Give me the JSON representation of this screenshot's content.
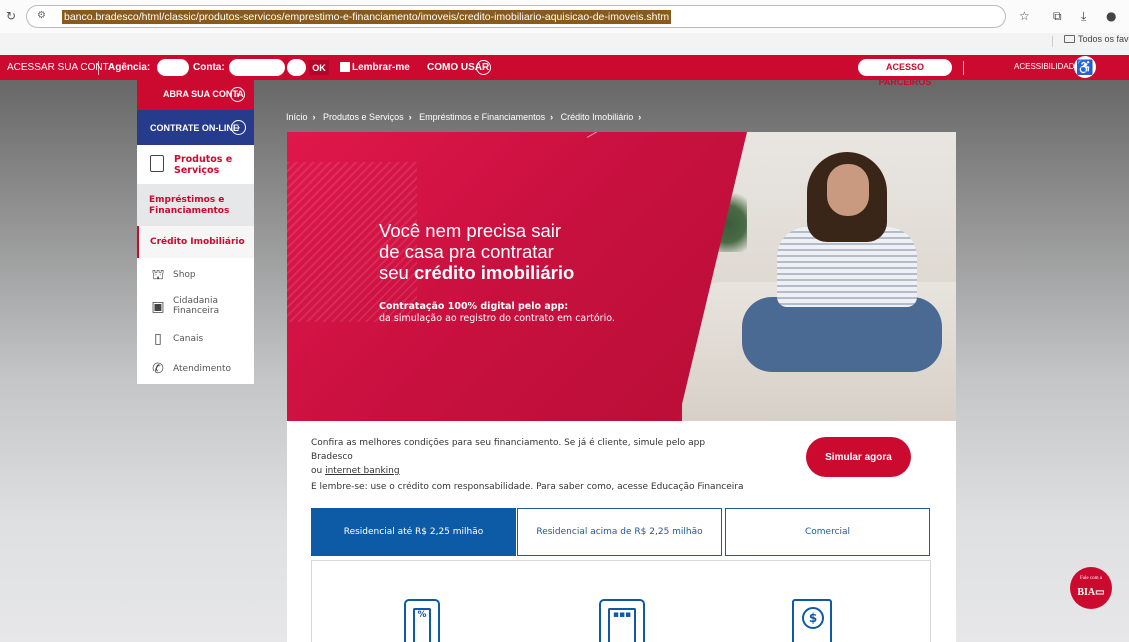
{
  "browser": {
    "url": "banco.bradesco/html/classic/produtos-servicos/emprestimo-e-financiamento/imoveis/credito-imobiliario-aquisicao-de-imoveis.shtm",
    "bookmarks_label": "Todos os favoritos"
  },
  "topbar": {
    "access_label": "ACESSAR SUA CONTA",
    "agency_label": "Agência:",
    "account_label": "Conta:",
    "ok_label": "OK",
    "remember_label": "Lembrar-me",
    "how_to_use_label": "COMO USAR",
    "partners_label": "ACESSO PARCEIROS",
    "accessibility_label": "ACESSIBILIDADE"
  },
  "menu": {
    "open_account": "ABRA SUA CONTA",
    "contract_online": "CONTRATE ON-LINE",
    "products": "Produtos e Serviços",
    "loans": "Empréstimos e Financiamentos",
    "current": "Crédito Imobiliário",
    "items": [
      {
        "label": "Shop"
      },
      {
        "label": "Cidadania Financeira"
      },
      {
        "label": "Canais"
      },
      {
        "label": "Atendimento"
      }
    ]
  },
  "breadcrumb": [
    "Início",
    "Produtos e Serviços",
    "Empréstimos e Financiamentos",
    "Crédito Imobiliário"
  ],
  "banner": {
    "line1": "Você nem precisa sair",
    "line2": "de casa pra contratar",
    "line3_prefix": "seu ",
    "line3_bold": "crédito imobiliário",
    "sub_bold": "Contratação 100% digital pelo app:",
    "sub_normal": "da simulação ao registro do contrato em cartório."
  },
  "content": {
    "intro_text": "Confira as melhores condições para seu financiamento. Se já é cliente, simule pelo app Bradesco",
    "intro_or": "ou ",
    "intro_link": "internet banking",
    "simulate_button": "Simular agora",
    "reminder_text": "E lembre-se: use o crédito com responsabilidade. Para saber como, acesse Educação Financeira",
    "tabs": [
      {
        "label": "Residencial até R$ 2,25 milhão",
        "active": true
      },
      {
        "label": "Residencial acima de R$ 2,25 milhão",
        "active": false
      },
      {
        "label": "Comercial",
        "active": false
      }
    ]
  },
  "chat": {
    "line1": "Fale com a",
    "line2": "BIA"
  },
  "colors": {
    "brand_red": "#cc092f",
    "brand_blue": "#263b8c",
    "tab_blue": "#0d5aa7"
  }
}
